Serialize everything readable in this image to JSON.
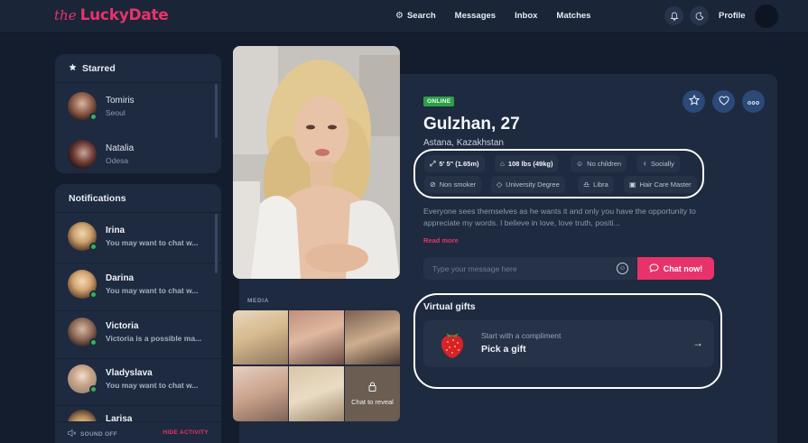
{
  "header": {
    "logo_prefix": "the",
    "logo_name": "LuckyDate",
    "nav": [
      {
        "label": "Search",
        "icon": "gear-icon"
      },
      {
        "label": "Messages"
      },
      {
        "label": "Inbox"
      },
      {
        "label": "Matches"
      }
    ],
    "notifications_icon": "bell-icon",
    "theme_icon": "moon-icon",
    "profile_label": "Profile"
  },
  "starred": {
    "title": "Starred",
    "items": [
      {
        "name": "Tomiris",
        "sub": "Seoul",
        "online": true
      },
      {
        "name": "Natalia",
        "sub": "Odesa",
        "online": false
      }
    ]
  },
  "notifications": {
    "title": "Notifications",
    "items": [
      {
        "name": "Irina",
        "message": "You may want to chat w..."
      },
      {
        "name": "Darina",
        "message": "You may want to chat w..."
      },
      {
        "name": "Victoria",
        "message": "Victoria is a possible ma..."
      },
      {
        "name": "Vladyslava",
        "message": "You may want to chat w..."
      },
      {
        "name": "Larisa",
        "message": ""
      }
    ],
    "sound_label": "SOUND OFF",
    "hide_label": "HIDE ACTIVITY"
  },
  "media": {
    "label": "MEDIA",
    "reveal_label": "Chat to reveal"
  },
  "profile": {
    "status": "ONLINE",
    "name_age": "Gulzhan, 27",
    "location": "Astana, Kazakhstan",
    "tags": [
      {
        "label": "5' 5\" (1.65m)",
        "icon": "height-icon",
        "strong": true
      },
      {
        "label": "108 lbs (49kg)",
        "icon": "weight-icon",
        "strong": true
      },
      {
        "label": "No children",
        "icon": "child-icon",
        "strong": false
      },
      {
        "label": "Socially",
        "icon": "glass-icon",
        "strong": false
      },
      {
        "label": "Non smoker",
        "icon": "no-smoking-icon",
        "strong": false
      },
      {
        "label": "University Degree",
        "icon": "education-icon",
        "strong": false
      },
      {
        "label": "Libra",
        "icon": "zodiac-icon",
        "strong": false
      },
      {
        "label": "Hair Care Master",
        "icon": "briefcase-icon",
        "strong": false
      }
    ],
    "about": "Everyone sees themselves as he wants it and only you have the opportunity to appreciate my words. I believe in love, love truth, positi...",
    "read_more": "Read more",
    "message_placeholder": "Type your message here",
    "chat_button": "Chat now!",
    "gifts_title": "Virtual gifts",
    "gift_subtitle": "Start with a compliment",
    "gift_action": "Pick a gift"
  },
  "colors": {
    "accent": "#e8336a",
    "online": "#2f9e4a",
    "background": "#141d2e",
    "panel": "#1e2a3f"
  }
}
